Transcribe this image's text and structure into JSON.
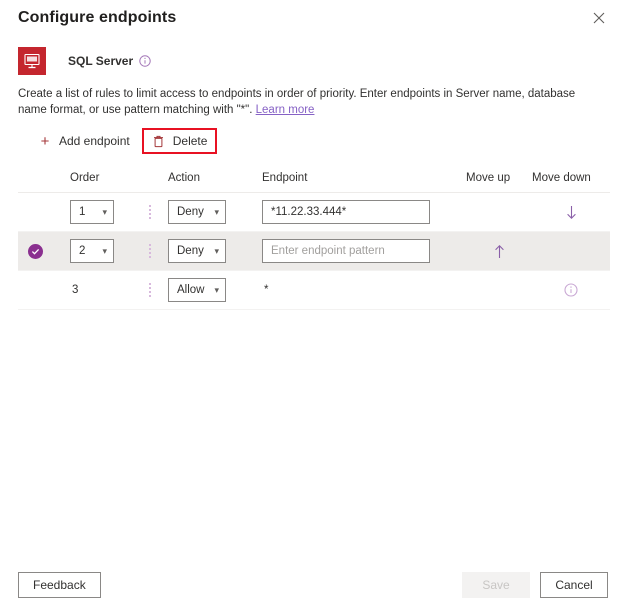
{
  "header": {
    "title": "Configure endpoints",
    "close_icon": "close-icon"
  },
  "resource": {
    "icon": "sql-server-icon",
    "icon_label": "SQL",
    "name": "SQL Server",
    "info_icon": "info-icon",
    "icon_color": "#c4262e"
  },
  "description": {
    "text_part1": "Create a list of rules to limit access to endpoints in order of priority. Enter endpoints in Server name, database name format, or use pattern matching with \"*\". ",
    "link_label": "Learn more",
    "link_color": "#8661c5"
  },
  "command_bar": {
    "add_label": "Add endpoint",
    "add_icon": "plus-icon",
    "delete_label": "Delete",
    "delete_icon": "trash-icon",
    "delete_highlighted": true,
    "highlight_color": "#e81123"
  },
  "table": {
    "columns": {
      "order": "Order",
      "action": "Action",
      "endpoint": "Endpoint",
      "move_up": "Move up",
      "move_down": "Move down"
    },
    "rows": [
      {
        "selected": false,
        "order": "1",
        "order_is_dropdown": true,
        "action": "Deny",
        "action_is_dropdown": true,
        "endpoint_value": "*11.22.33.444*",
        "endpoint_placeholder": "Enter endpoint pattern",
        "endpoint_is_input": true,
        "move_up_icon": "",
        "move_down_icon": "arrow-down-icon",
        "row_info_icon": ""
      },
      {
        "selected": true,
        "order": "2",
        "order_is_dropdown": true,
        "action": "Deny",
        "action_is_dropdown": true,
        "endpoint_value": "",
        "endpoint_placeholder": "Enter endpoint pattern",
        "endpoint_is_input": true,
        "move_up_icon": "arrow-up-icon",
        "move_down_icon": "",
        "row_info_icon": ""
      },
      {
        "selected": false,
        "order": "3",
        "order_is_dropdown": false,
        "action": "Allow",
        "action_is_dropdown": true,
        "endpoint_value": "*",
        "endpoint_placeholder": "",
        "endpoint_is_input": false,
        "move_up_icon": "",
        "move_down_icon": "",
        "row_info_icon": "info-icon"
      }
    ],
    "selection_color": "#8a2f8f",
    "arrow_color": "#8a5fa8"
  },
  "footer": {
    "feedback_label": "Feedback",
    "save_label": "Save",
    "save_disabled": true,
    "cancel_label": "Cancel"
  }
}
